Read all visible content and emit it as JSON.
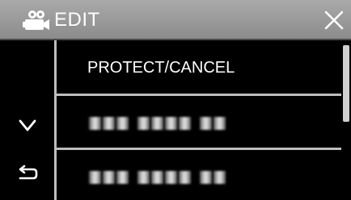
{
  "header": {
    "title": "EDIT",
    "mode_icon": "video-camera-icon",
    "close_icon": "close-icon"
  },
  "side_buttons": {
    "down_icon": "chevron-down-icon",
    "back_icon": "return-arrow-icon"
  },
  "menu": {
    "items": [
      {
        "label": "PROTECT/CANCEL"
      },
      {
        "label": "",
        "blurred": true
      },
      {
        "label": "",
        "blurred": true
      }
    ]
  },
  "scrollbar": {
    "position": 0.0
  },
  "colors": {
    "header_bg": "#999999",
    "background": "#000000",
    "divider": "#bdbdbd",
    "text": "#ffffff"
  }
}
